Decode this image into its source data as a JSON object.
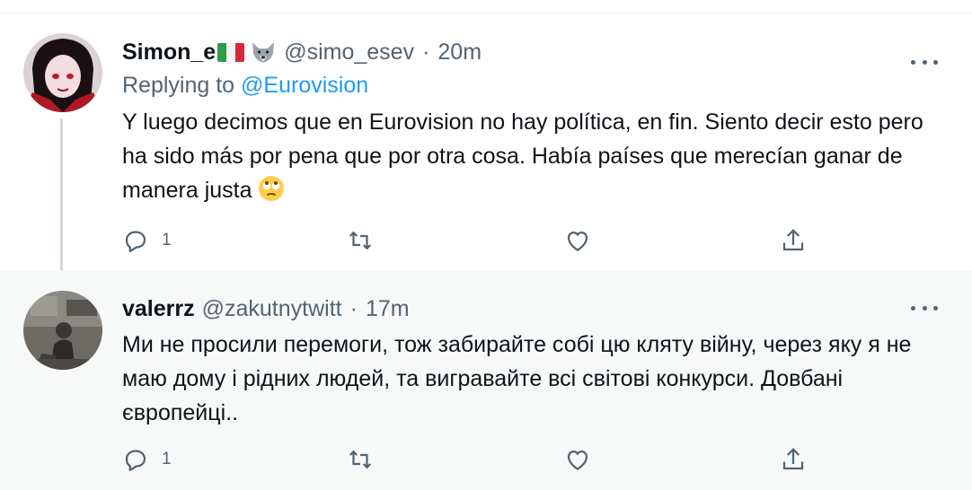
{
  "tweets": [
    {
      "display_name": "Simon_e",
      "handle": "@simo_esev",
      "separator": "·",
      "time": "20m",
      "reply_prefix": "Replying to ",
      "reply_to": "@Eurovision",
      "text": "Y luego decimos que en Eurovision no hay política,  en fin. Siento decir esto pero ha sido más por pena que por otra cosa. Había países que merecían ganar de manera justa",
      "emoji": "face-with-rolling-eyes",
      "reply_count": "1",
      "icons": [
        "italy-flag",
        "wolf-icon",
        "more-icon",
        "reply-icon",
        "retweet-icon",
        "like-icon",
        "share-icon"
      ]
    },
    {
      "display_name": "valerrz",
      "handle": "@zakutnytwitt",
      "separator": "·",
      "time": "17m",
      "text": "Ми не просили перемоги, тож забирайте собі цю кляту війну, через яку я не маю дому і рідних людей, та вигравайте всі світові конкурси. Довбані європейці..",
      "reply_count": "1",
      "icons": [
        "more-icon",
        "reply-icon",
        "retweet-icon",
        "like-icon",
        "share-icon"
      ]
    }
  ],
  "colors": {
    "text": "#0f1419",
    "secondary": "#536471",
    "link": "#1d9bf0",
    "thread_line": "#cfd9de",
    "highlight_bg": "#f7f9f9"
  }
}
